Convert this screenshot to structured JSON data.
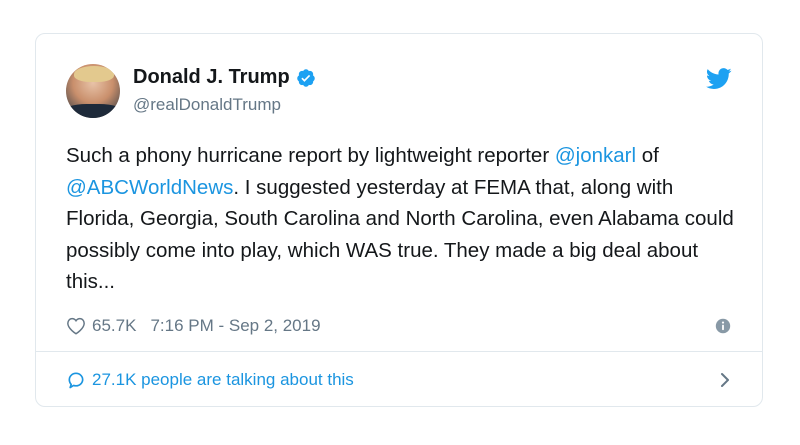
{
  "author": {
    "display_name": "Donald J. Trump",
    "handle": "@realDonaldTrump",
    "verified": true
  },
  "tweet": {
    "segments": [
      {
        "text": "Such a phony hurricane report by lightweight reporter ",
        "type": "text"
      },
      {
        "text": "@jonkarl",
        "type": "mention"
      },
      {
        "text": " of ",
        "type": "text"
      },
      {
        "text": "@ABCWorldNews",
        "type": "mention"
      },
      {
        "text": ". I suggested yesterday at FEMA that, along with Florida, Georgia, South Carolina and North Carolina, even Alabama could possibly come into play, which WAS true. They made a big deal about this...",
        "type": "text"
      }
    ]
  },
  "meta": {
    "likes": "65.7K",
    "timestamp": "7:16 PM - Sep 2, 2019"
  },
  "footer": {
    "talking": "27.1K people are talking about this"
  },
  "colors": {
    "accent": "#1b95e0",
    "muted": "#657786",
    "border": "#e1e8ed"
  }
}
